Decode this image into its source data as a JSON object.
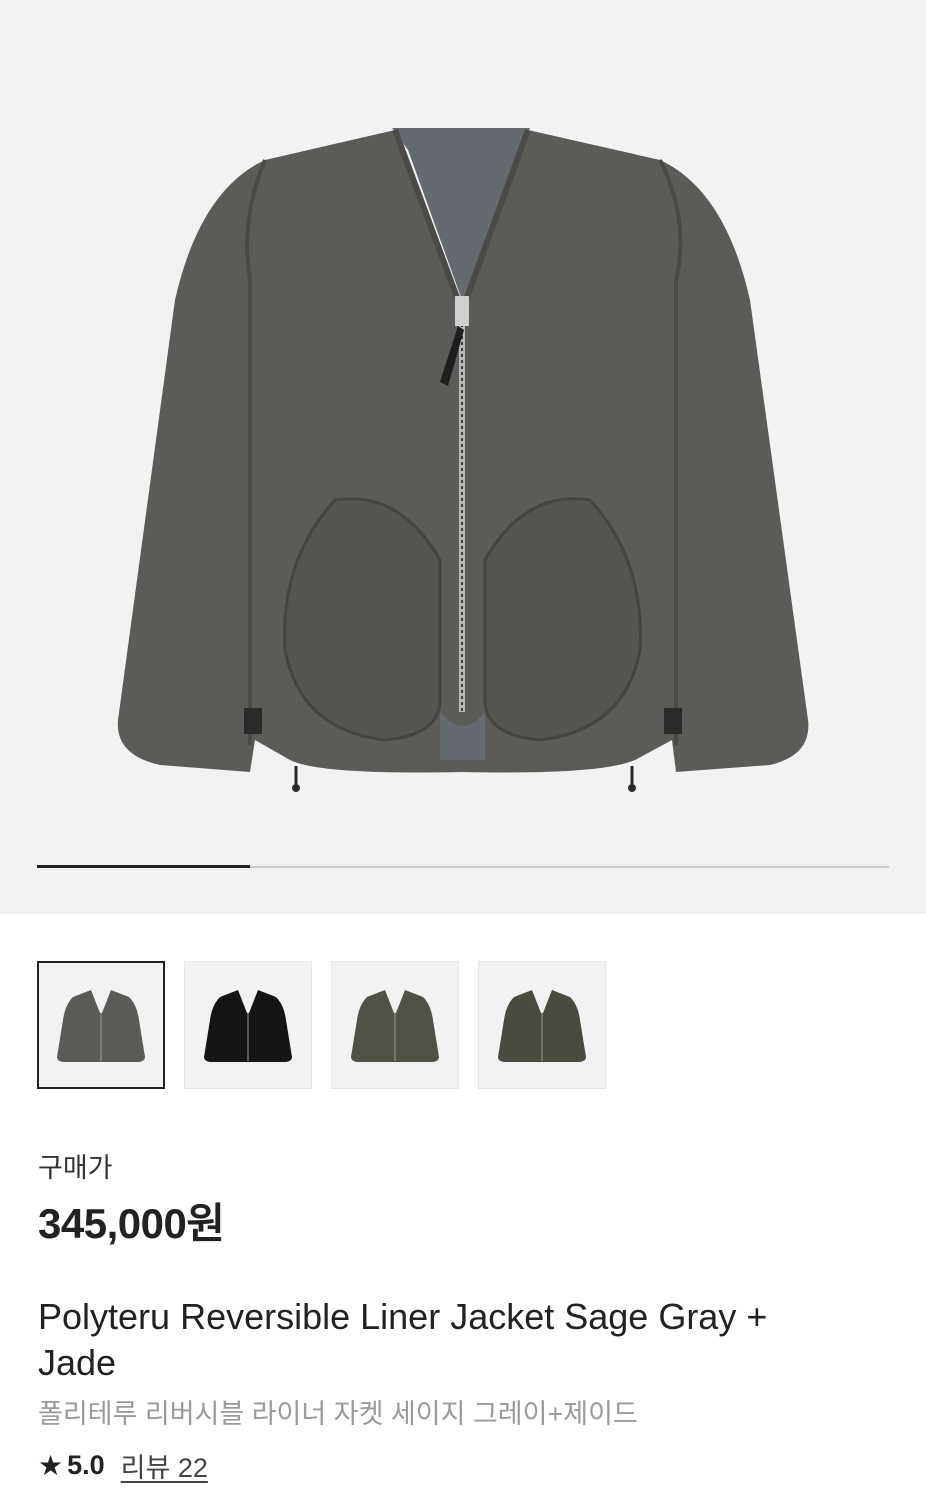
{
  "product": {
    "image_alt": "Polyteru Reversible Liner Jacket Sage Gray + Jade",
    "gallery_progress": 0.25,
    "thumbnails": [
      {
        "name": "Sage Gray",
        "color": "#5a5a57",
        "selected": true
      },
      {
        "name": "Black",
        "color": "#141414",
        "selected": false
      },
      {
        "name": "Olive",
        "color": "#505248",
        "selected": false
      },
      {
        "name": "Dark Brown Olive",
        "color": "#4a4a40",
        "selected": false
      }
    ],
    "price_label": "구매가",
    "price": "345,000원",
    "name_en": "Polyteru Reversible Liner Jacket Sage Gray + Jade",
    "name_ko": "폴리테루 리버시블 라이너 자켓 세이지 그레이+제이드",
    "rating_icon": "star-icon",
    "rating": "5.0",
    "reviews": "리뷰 22"
  },
  "colors": {
    "hero_bg": "#f2f2f2",
    "jacket": "#5b5b58",
    "jacket_shadow": "#4a4a47",
    "lining": "#646a70"
  }
}
